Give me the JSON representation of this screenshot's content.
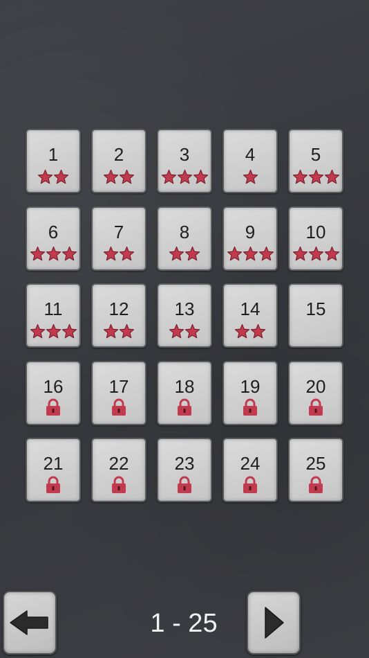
{
  "levels": [
    {
      "label": "1",
      "stars": 2,
      "locked": false
    },
    {
      "label": "2",
      "stars": 2,
      "locked": false
    },
    {
      "label": "3",
      "stars": 3,
      "locked": false
    },
    {
      "label": "4",
      "stars": 1,
      "locked": false
    },
    {
      "label": "5",
      "stars": 3,
      "locked": false
    },
    {
      "label": "6",
      "stars": 3,
      "locked": false
    },
    {
      "label": "7",
      "stars": 2,
      "locked": false
    },
    {
      "label": "8",
      "stars": 2,
      "locked": false
    },
    {
      "label": "9",
      "stars": 3,
      "locked": false
    },
    {
      "label": "10",
      "stars": 3,
      "locked": false
    },
    {
      "label": "11",
      "stars": 3,
      "locked": false
    },
    {
      "label": "12",
      "stars": 2,
      "locked": false
    },
    {
      "label": "13",
      "stars": 2,
      "locked": false
    },
    {
      "label": "14",
      "stars": 2,
      "locked": false
    },
    {
      "label": "15",
      "stars": 0,
      "locked": false
    },
    {
      "label": "16",
      "stars": 0,
      "locked": true
    },
    {
      "label": "17",
      "stars": 0,
      "locked": true
    },
    {
      "label": "18",
      "stars": 0,
      "locked": true
    },
    {
      "label": "19",
      "stars": 0,
      "locked": true
    },
    {
      "label": "20",
      "stars": 0,
      "locked": true
    },
    {
      "label": "21",
      "stars": 0,
      "locked": true
    },
    {
      "label": "22",
      "stars": 0,
      "locked": true
    },
    {
      "label": "23",
      "stars": 0,
      "locked": true
    },
    {
      "label": "24",
      "stars": 0,
      "locked": true
    },
    {
      "label": "25",
      "stars": 0,
      "locked": true
    }
  ],
  "pager": {
    "range_label": "1 - 25",
    "prev_icon": "arrow-left-icon",
    "next_icon": "triangle-right-icon"
  },
  "colors": {
    "star": "#c23a4d",
    "star_outline": "#7a1e2b",
    "lock": "#c23a4d",
    "tile": "#d2d2d2",
    "background": "#3a3b40",
    "page_label": "#f2f2f2"
  }
}
